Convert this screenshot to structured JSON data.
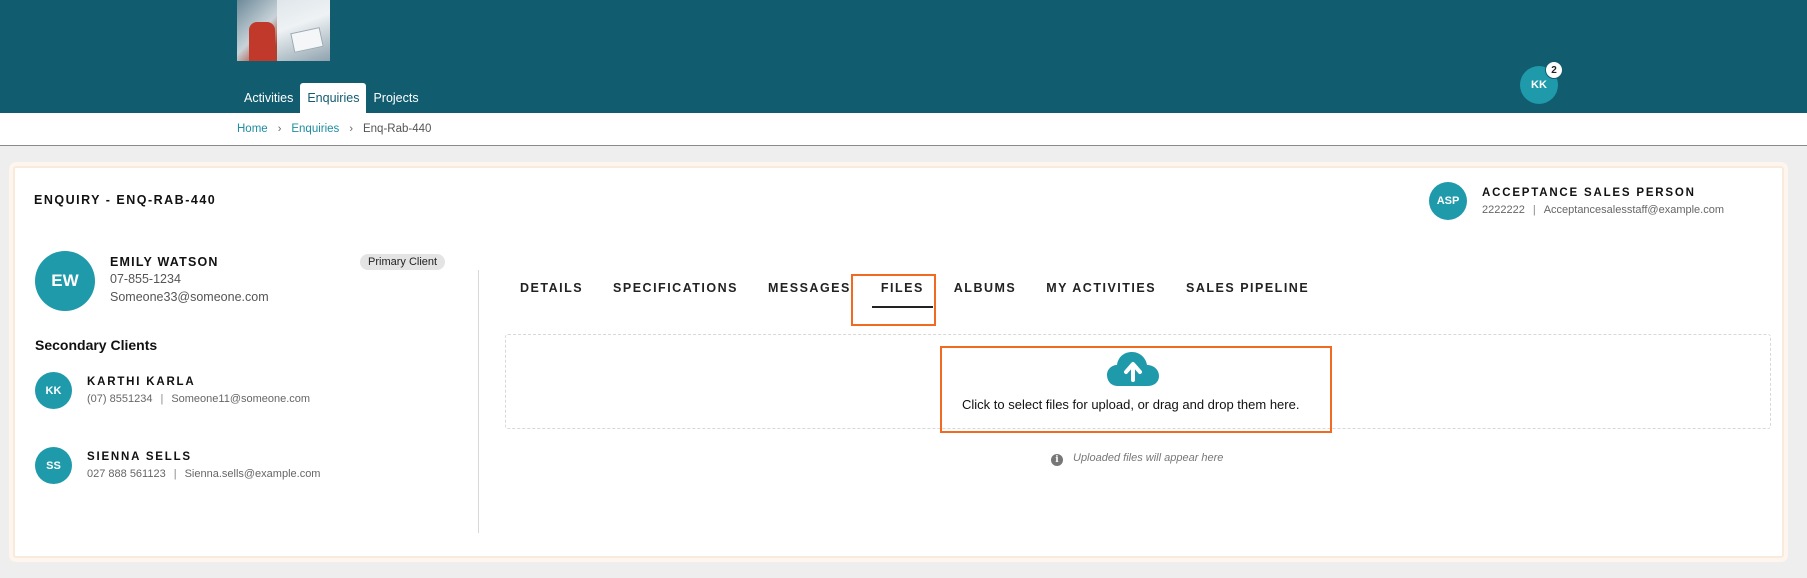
{
  "header": {
    "nav": [
      {
        "label": "Activities"
      },
      {
        "label": "Enquiries"
      },
      {
        "label": "Projects"
      }
    ],
    "user_initials": "KK",
    "notification_count": "2",
    "brand_color": "#125c70"
  },
  "breadcrumb": {
    "home": "Home",
    "enquiries": "Enquiries",
    "current": "Enq-Rab-440"
  },
  "enquiry": {
    "title": "ENQUIRY - ENQ-RAB-440"
  },
  "sales_person": {
    "initials": "ASP",
    "name": "ACCEPTANCE SALES PERSON",
    "phone": "2222222",
    "email": "Acceptancesalesstaff@example.com"
  },
  "primary_client": {
    "initials": "EW",
    "name": "EMILY WATSON",
    "phone": "07-855-1234",
    "email": "Someone33@someone.com",
    "badge": "Primary Client"
  },
  "secondary_clients": {
    "title": "Secondary Clients",
    "items": [
      {
        "initials": "KK",
        "name": "KARTHI KARLA",
        "phone": "(07) 8551234",
        "email": "Someone11@someone.com"
      },
      {
        "initials": "SS",
        "name": "SIENNA SELLS",
        "phone": "027 888 561123",
        "email": "Sienna.sells@example.com"
      }
    ]
  },
  "tabs": [
    {
      "label": "DETAILS"
    },
    {
      "label": "SPECIFICATIONS"
    },
    {
      "label": "MESSAGES"
    },
    {
      "label": "FILES"
    },
    {
      "label": "ALBUMS"
    },
    {
      "label": "MY ACTIVITIES"
    },
    {
      "label": "SALES PIPELINE"
    }
  ],
  "active_tab": "FILES",
  "files": {
    "upload_text": "Click to select files for upload, or drag and drop them here.",
    "empty_note": "Uploaded files will appear here",
    "upload_icon": "cloud-upload-icon",
    "info_icon": "info-icon"
  },
  "colors": {
    "accent": "#1f9aab",
    "highlight": "#f06a21"
  }
}
